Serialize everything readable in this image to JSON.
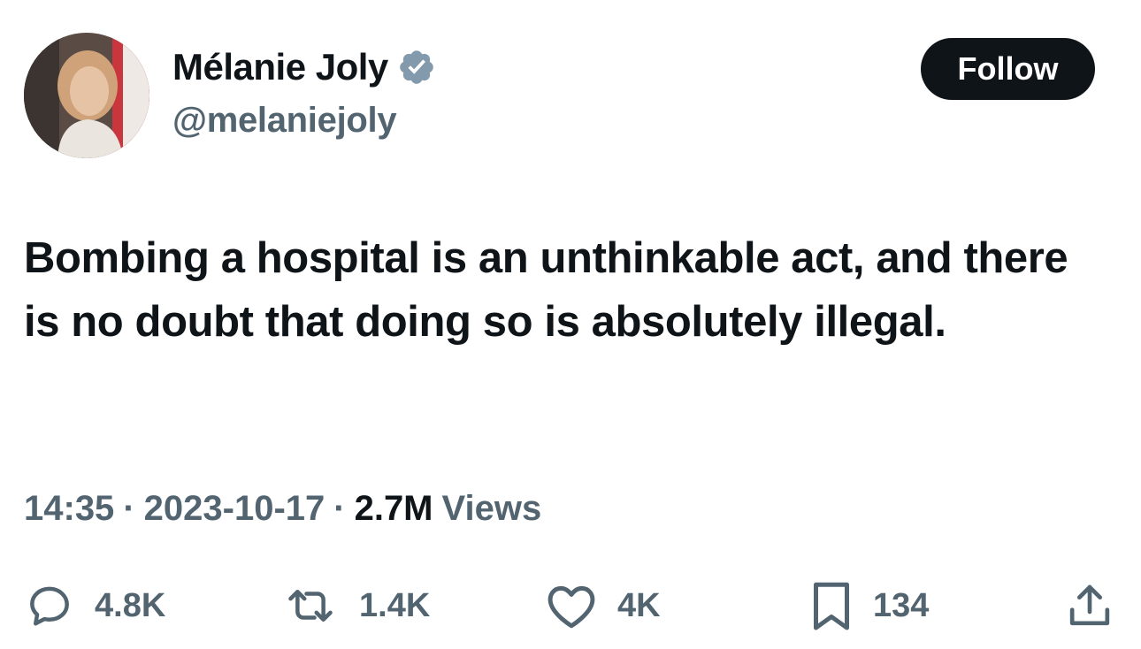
{
  "author": {
    "name": "Mélanie Joly",
    "handle": "@melaniejoly",
    "verified": true,
    "verified_color": "#829aab"
  },
  "follow_label": "Follow",
  "tweet": {
    "text": "Bombing a hospital is an unthinkable act, and there is no doubt that doing so is absolutely illegal."
  },
  "meta": {
    "time": "14:35",
    "separator": "·",
    "date": "2023-10-17",
    "views_count": "2.7M",
    "views_label": "Views"
  },
  "actions": {
    "replies": {
      "icon": "reply-icon",
      "count": "4.8K"
    },
    "reposts": {
      "icon": "repost-icon",
      "count": "1.4K"
    },
    "likes": {
      "icon": "heart-icon",
      "count": "4K"
    },
    "bookmarks": {
      "icon": "bookmark-icon",
      "count": "134"
    },
    "share": {
      "icon": "share-icon"
    }
  },
  "colors": {
    "text_primary": "#0f1419",
    "text_secondary": "#536471",
    "button_bg": "#0f1419",
    "button_text": "#ffffff"
  }
}
